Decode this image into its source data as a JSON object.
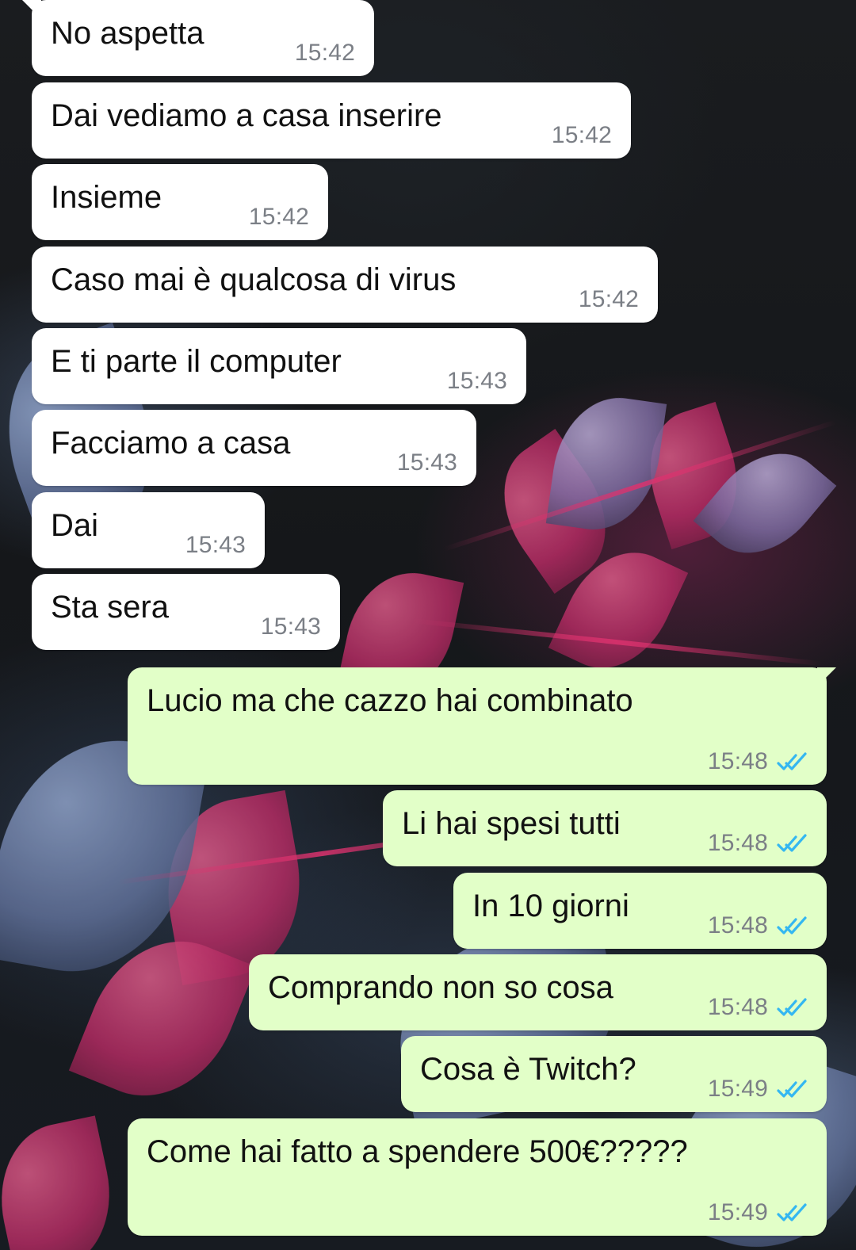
{
  "conversation": {
    "messages": [
      {
        "direction": "incoming",
        "text": "No aspetta",
        "time": "15:42"
      },
      {
        "direction": "incoming",
        "text": "Dai vediamo a casa inserire",
        "time": "15:42"
      },
      {
        "direction": "incoming",
        "text": "Insieme",
        "time": "15:42"
      },
      {
        "direction": "incoming",
        "text": "Caso mai è qualcosa di virus",
        "time": "15:42"
      },
      {
        "direction": "incoming",
        "text": "E ti parte il computer",
        "time": "15:43"
      },
      {
        "direction": "incoming",
        "text": "Facciamo a casa",
        "time": "15:43"
      },
      {
        "direction": "incoming",
        "text": "Dai",
        "time": "15:43"
      },
      {
        "direction": "incoming",
        "text": "Sta sera",
        "time": "15:43"
      },
      {
        "direction": "outgoing",
        "text": "Lucio ma che cazzo hai combinato",
        "time": "15:48",
        "status_icon": "double-check-read"
      },
      {
        "direction": "outgoing",
        "text": "Li hai spesi tutti",
        "time": "15:48",
        "status_icon": "double-check-read"
      },
      {
        "direction": "outgoing",
        "text": "In 10 giorni",
        "time": "15:48",
        "status_icon": "double-check-read"
      },
      {
        "direction": "outgoing",
        "text": "Comprando non so cosa",
        "time": "15:48",
        "status_icon": "double-check-read"
      },
      {
        "direction": "outgoing",
        "text": "Cosa è Twitch?",
        "time": "15:49",
        "status_icon": "double-check-read"
      },
      {
        "direction": "outgoing",
        "text": "Come hai fatto a spendere 500€?????",
        "time": "15:49",
        "status_icon": "double-check-read"
      }
    ]
  },
  "colors": {
    "incoming_bubble": "#ffffff",
    "outgoing_bubble": "#e2ffc8",
    "time_text": "#7b7f86",
    "read_ticks": "#34b7f1",
    "wallpaper_dark": "#15171a",
    "wallpaper_pink": "#b22b62",
    "wallpaper_blue": "#5f6f97"
  }
}
